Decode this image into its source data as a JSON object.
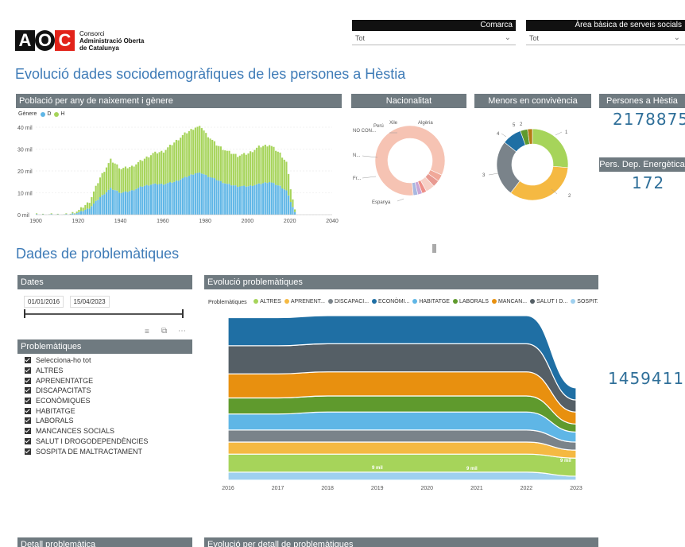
{
  "logo": {
    "letters": [
      "A",
      "O",
      "C"
    ],
    "line1": "Consorci",
    "line2": "Administració Oberta",
    "line3": "de Catalunya"
  },
  "filters": {
    "comarca": {
      "label": "Comarca",
      "value": "Tot"
    },
    "abss": {
      "label": "Àrea bàsica de serveis socials",
      "value": "Tot"
    }
  },
  "titles": {
    "main": "Evolució dades sociodemogràfiques de les persones a Hèstia",
    "problems": "Dades de problemàtiques"
  },
  "population": {
    "header": "Població per any de naixement i gènere",
    "legend_title": "Gènere",
    "legend_d": "D",
    "legend_h": "H"
  },
  "nationality": {
    "header": "Nacionalitat",
    "labels": {
      "peru": "Perú",
      "xile": "Xile",
      "algeria": "Algèria",
      "nocon": "NO CON...",
      "n": "N...",
      "fr": "Fr...",
      "espanya": "Espanya"
    }
  },
  "minors": {
    "header": "Menors en convivència",
    "labels": [
      "5",
      "2",
      "4",
      "1",
      "3",
      "2"
    ]
  },
  "kpis": {
    "persones_label": "Persones a Hèstia",
    "persones_value": "2178875",
    "dep_label": "Pers. Dep. Energètica",
    "dep_value": "172",
    "problems_value": "1459411"
  },
  "dates": {
    "header": "Dates",
    "from": "01/01/2016",
    "to": "15/04/2023"
  },
  "problem_list": {
    "header": "Problemàtiques",
    "items": [
      "Selecciona-ho tot",
      "ALTRES",
      "APRENENTATGE",
      "DISCAPACITATS",
      "ECONÒMIQUES",
      "HABITATGE",
      "LABORALS",
      "MANCANCES SOCIALS",
      "SALUT I DROGODEPENDÈNCIES",
      "SOSPITA DE MALTRACTAMENT"
    ]
  },
  "evolution": {
    "header": "Evolució problemàtiques",
    "legend_title": "Problemàtiques",
    "legend": [
      {
        "name": "ALTRES",
        "color": "#a6d45a"
      },
      {
        "name": "APRENENT...",
        "color": "#f5b942"
      },
      {
        "name": "DISCAPACI...",
        "color": "#7a838a"
      },
      {
        "name": "ECONÒMI...",
        "color": "#1f6fa4"
      },
      {
        "name": "HABITATGE",
        "color": "#5fb6e6"
      },
      {
        "name": "LABORALS",
        "color": "#5f9a2d"
      },
      {
        "name": "MANCAN...",
        "color": "#e8900f"
      },
      {
        "name": "SALUT I D...",
        "color": "#555f66"
      },
      {
        "name": "SOSPITA D...",
        "color": "#9fd0ef"
      }
    ],
    "labels": [
      "9 mil",
      "9 mil",
      "9 mil"
    ]
  },
  "bottom": {
    "detail": "Detall problemàtica",
    "evo_detail": "Evolució per detall de problemàtiques"
  },
  "chart_data": [
    {
      "type": "area",
      "title": "Població per any de naixement i gènere",
      "x": [
        1900,
        1905,
        1910,
        1915,
        1920,
        1925,
        1930,
        1935,
        1940,
        1945,
        1950,
        1955,
        1960,
        1965,
        1970,
        1975,
        1978,
        1980,
        1985,
        1990,
        1995,
        2000,
        2005,
        2010,
        2015,
        2018,
        2020,
        2022
      ],
      "series": [
        {
          "name": "D",
          "values": [
            0,
            0,
            0,
            0,
            1,
            3,
            8,
            12,
            10,
            11,
            13,
            14,
            14,
            15,
            17,
            19,
            19,
            18,
            16,
            14,
            13,
            13,
            14,
            15,
            13,
            11,
            6,
            1
          ]
        },
        {
          "name": "H",
          "values": [
            0,
            0,
            0,
            0,
            1,
            3,
            9,
            13,
            11,
            11,
            12,
            14,
            15,
            18,
            20,
            21,
            21,
            19,
            16,
            15,
            14,
            15,
            17,
            17,
            15,
            13,
            6,
            1
          ]
        }
      ],
      "xlim": [
        1900,
        2040
      ],
      "ylim": [
        0,
        40
      ],
      "yticks": [
        "0 mil",
        "10 mil",
        "20 mil",
        "30 mil",
        "40 mil"
      ],
      "xticks": [
        "1900",
        "1920",
        "1940",
        "1960",
        "1980",
        "2000",
        "2020",
        "2040"
      ]
    },
    {
      "type": "pie",
      "title": "Nacionalitat",
      "categories": [
        "Espanya",
        "Fr...",
        "N...",
        "NO CON...",
        "Perú",
        "Xile",
        "Algèria"
      ],
      "values": [
        80,
        3,
        3,
        4,
        2,
        2,
        2
      ]
    },
    {
      "type": "pie",
      "title": "Menors en convivència",
      "categories": [
        "1",
        "2",
        "3",
        "4",
        "5",
        "2"
      ],
      "values": [
        24,
        31,
        23,
        8,
        3,
        2
      ]
    },
    {
      "type": "area",
      "title": "Evolució problemàtiques",
      "categories": [
        "2016",
        "2017",
        "2018",
        "2019",
        "2020",
        "2021",
        "2022",
        "2023"
      ],
      "series": [
        {
          "name": "ALTRES",
          "values": [
            9,
            9,
            9,
            9,
            9,
            9,
            9,
            9
          ]
        },
        {
          "name": "APRENENT...",
          "values": [
            6,
            6,
            6,
            6,
            6,
            6,
            6,
            4
          ]
        },
        {
          "name": "DISCAPACI...",
          "values": [
            6,
            6,
            6,
            6,
            6,
            6,
            6,
            4
          ]
        },
        {
          "name": "ECONÒMI...",
          "values": [
            14,
            14,
            14,
            14,
            14,
            14,
            14,
            6
          ]
        },
        {
          "name": "HABITATGE",
          "values": [
            8,
            8,
            9,
            9,
            9,
            9,
            9,
            5
          ]
        },
        {
          "name": "LABORALS",
          "values": [
            8,
            8,
            8,
            8,
            8,
            8,
            8,
            4
          ]
        },
        {
          "name": "MANCAN...",
          "values": [
            12,
            12,
            12,
            12,
            12,
            12,
            12,
            6
          ]
        },
        {
          "name": "SALUT I D...",
          "values": [
            14,
            14,
            14,
            14,
            14,
            14,
            14,
            6
          ]
        },
        {
          "name": "SOSPITA D...",
          "values": [
            4,
            4,
            4,
            4,
            4,
            4,
            4,
            2
          ]
        }
      ]
    }
  ]
}
